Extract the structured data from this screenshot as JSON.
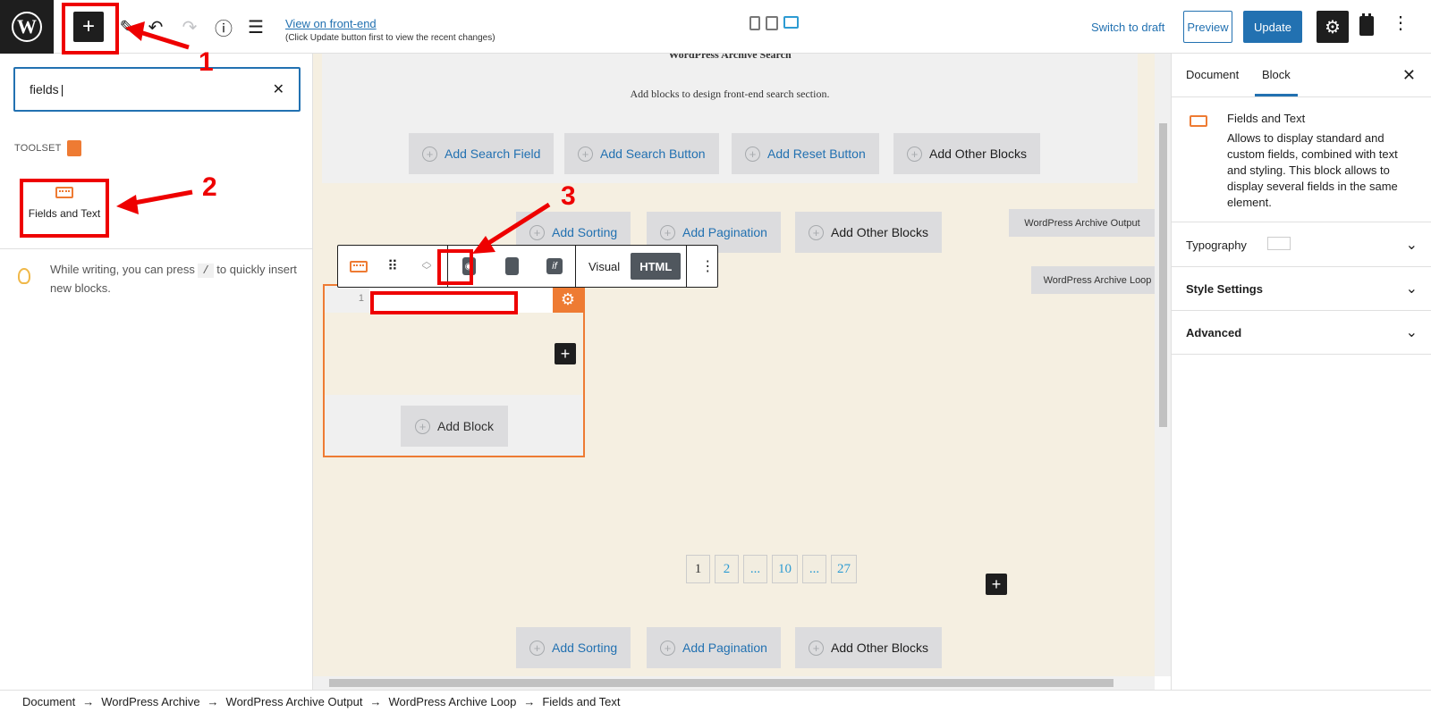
{
  "topbar": {
    "add_icon": "plus-icon",
    "view_frontend": "View on front-end",
    "view_note": "(Click Update button first to view the recent changes)",
    "switch_draft": "Switch to draft",
    "preview": "Preview",
    "update": "Update"
  },
  "inserter": {
    "search_value": "fields",
    "category": "TOOLSET",
    "block_label": "Fields and Text",
    "tip_before": "While writing, you can press",
    "tip_key": "/",
    "tip_after": "to quickly insert new blocks."
  },
  "canvas": {
    "search_heading": "WordPress Archive Search",
    "search_desc": "Add blocks to design front-end search section.",
    "search_buttons": [
      "Add Search Field",
      "Add Search Button",
      "Add Reset Button",
      "Add Other Blocks"
    ],
    "output_buttons": [
      "Add Sorting",
      "Add Pagination",
      "Add Other Blocks"
    ],
    "output_tag": "WordPress Archive Output",
    "loop_tag": "WordPress Archive Loop",
    "toolbar_visual": "Visual",
    "toolbar_html": "HTML",
    "toolbar_if": "if",
    "line_number": "1",
    "add_block": "Add Block",
    "pagination": [
      "1",
      "2",
      "...",
      "10",
      "...",
      "27"
    ],
    "bottom_buttons": [
      "Add Sorting",
      "Add Pagination",
      "Add Other Blocks"
    ]
  },
  "sidebar": {
    "tab_document": "Document",
    "tab_block": "Block",
    "block_title": "Fields and Text",
    "block_desc": "Allows to display standard and custom fields, combined with text and styling. This block allows to display several fields in the same element.",
    "panels": [
      "Typography",
      "Style Settings",
      "Advanced"
    ]
  },
  "breadcrumb": [
    "Document",
    "WordPress Archive",
    "WordPress Archive Output",
    "WordPress Archive Loop",
    "Fields and Text"
  ],
  "annotations": [
    "1",
    "2",
    "3"
  ],
  "colors": {
    "accent": "#2271b1",
    "toolset": "#ee7b33",
    "annotation": "#e00000"
  }
}
